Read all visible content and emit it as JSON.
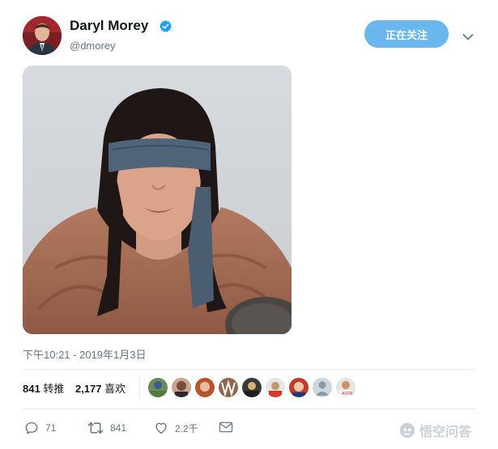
{
  "author": {
    "name": "Daryl Morey",
    "handle": "@dmorey",
    "verified": true
  },
  "follow_button": {
    "label": "正在关注"
  },
  "tweet": {
    "timestamp": "下午10:21 - 2019年1月3日"
  },
  "stats": {
    "retweets_count": "841",
    "retweets_label": "转推",
    "likes_count": "2,177",
    "likes_label": "喜欢"
  },
  "actions": {
    "reply_count": "71",
    "retweet_count": "841",
    "like_count": "2.2千"
  },
  "watermark": {
    "text": "悟空问答"
  },
  "colors": {
    "accent": "#69b7ee",
    "verified": "#1da1f2",
    "secondary_text": "#657786"
  }
}
